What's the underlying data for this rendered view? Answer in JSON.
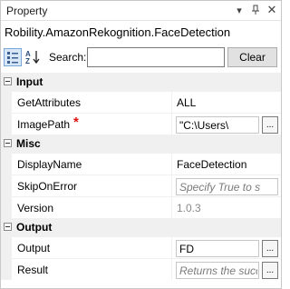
{
  "panel": {
    "title": "Property",
    "dropdown_glyph": "▾",
    "pin_glyph": "⊥",
    "close_glyph": "✕"
  },
  "component_name": "Robility.AmazonRekognition.FaceDetection",
  "toolbar": {
    "search_label": "Search:",
    "search_value": "",
    "clear_label": "Clear",
    "alpha_glyph": "A↓"
  },
  "categories": {
    "input": {
      "label": "Input",
      "rows": [
        {
          "name": "GetAttributes",
          "value": "ALL"
        },
        {
          "name": "ImagePath",
          "value": "\"C:\\Users\\",
          "required": "*"
        }
      ]
    },
    "misc": {
      "label": "Misc",
      "rows": [
        {
          "name": "DisplayName",
          "value": "FaceDetection"
        },
        {
          "name": "SkipOnError",
          "value": "Specify True to s"
        },
        {
          "name": "Version",
          "value": "1.0.3"
        }
      ]
    },
    "output": {
      "label": "Output",
      "rows": [
        {
          "name": "Output",
          "value": "FD"
        },
        {
          "name": "Result",
          "value": "Returns the succ"
        }
      ]
    }
  },
  "ellipsis_label": "..."
}
